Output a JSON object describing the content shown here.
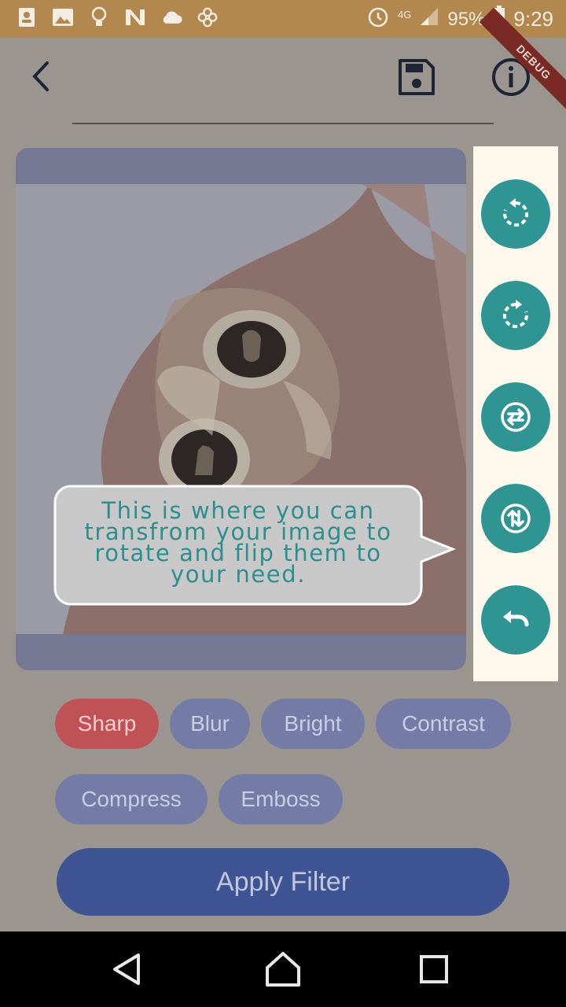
{
  "status_bar": {
    "left_icons": [
      "contacts-icon",
      "image-icon",
      "bulb-icon",
      "n-icon",
      "cloud-icon",
      "pinwheel-icon"
    ],
    "network": "4G",
    "battery": "95%",
    "time": "9:29"
  },
  "app_bar": {
    "back_icon": "back-arrow-icon",
    "save_icon": "save-icon",
    "info_icon": "info-icon",
    "debug_banner": "DEBUG"
  },
  "transform_tools": [
    {
      "name": "rotate-left",
      "icon": "rotate-left-icon"
    },
    {
      "name": "rotate-right",
      "icon": "rotate-right-icon"
    },
    {
      "name": "flip-horizontal",
      "icon": "flip-horizontal-icon"
    },
    {
      "name": "flip-vertical",
      "icon": "flip-vertical-icon"
    },
    {
      "name": "undo",
      "icon": "undo-icon"
    }
  ],
  "tooltip": {
    "text": "This is where you can transfrom your image to rotate and flip them to your need."
  },
  "filters": [
    {
      "label": "Sharp",
      "active": true
    },
    {
      "label": "Blur",
      "active": false
    },
    {
      "label": "Bright",
      "active": false
    },
    {
      "label": "Contrast",
      "active": false
    },
    {
      "label": "Compress",
      "active": false
    },
    {
      "label": "Emboss",
      "active": false
    }
  ],
  "apply_button": {
    "label": "Apply Filter"
  },
  "nav_bar": {
    "icons": [
      "back-triangle-icon",
      "home-icon",
      "recents-icon"
    ]
  },
  "colors": {
    "accent_teal": "#2f9592",
    "active_chip": "#c05155",
    "chip": "#747ca6",
    "apply": "#3f5492",
    "status_bar": "#b3884e"
  }
}
